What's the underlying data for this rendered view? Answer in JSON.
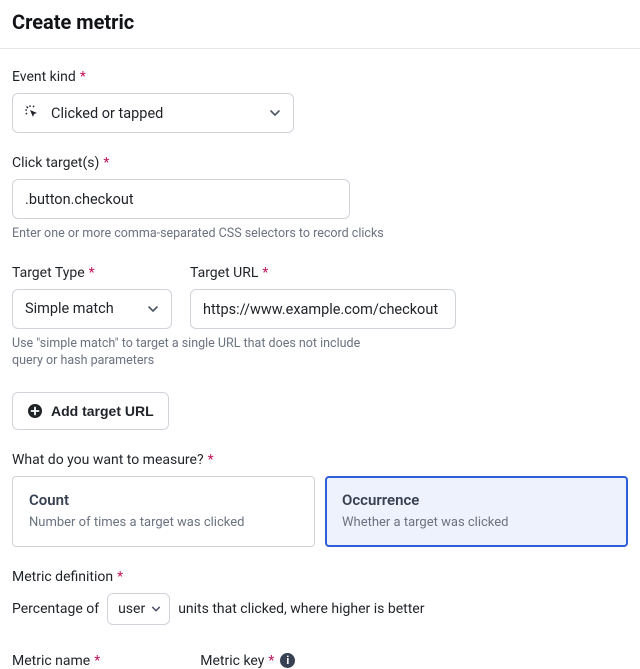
{
  "header": {
    "title": "Create metric"
  },
  "eventKind": {
    "label": "Event kind",
    "value": "Clicked or tapped"
  },
  "clickTargets": {
    "label": "Click target(s)",
    "value": ".button.checkout",
    "help": "Enter one or more comma-separated CSS selectors to record clicks"
  },
  "targetType": {
    "label": "Target Type",
    "value": "Simple match",
    "help": "Use \"simple match\" to target a single URL that does not include query or hash parameters"
  },
  "targetUrl": {
    "label": "Target URL",
    "value": "https://www.example.com/checkout"
  },
  "addTargetBtn": "Add target URL",
  "measure": {
    "label": "What do you want to measure?",
    "options": [
      {
        "title": "Count",
        "desc": "Number of times a target was clicked",
        "selected": false
      },
      {
        "title": "Occurrence",
        "desc": "Whether a target was clicked",
        "selected": true
      }
    ]
  },
  "definition": {
    "label": "Metric definition",
    "prefix": "Percentage of",
    "unit": "user",
    "suffix": "units that clicked, where higher is better"
  },
  "metricName": {
    "label": "Metric name"
  },
  "metricKey": {
    "label": "Metric key"
  }
}
